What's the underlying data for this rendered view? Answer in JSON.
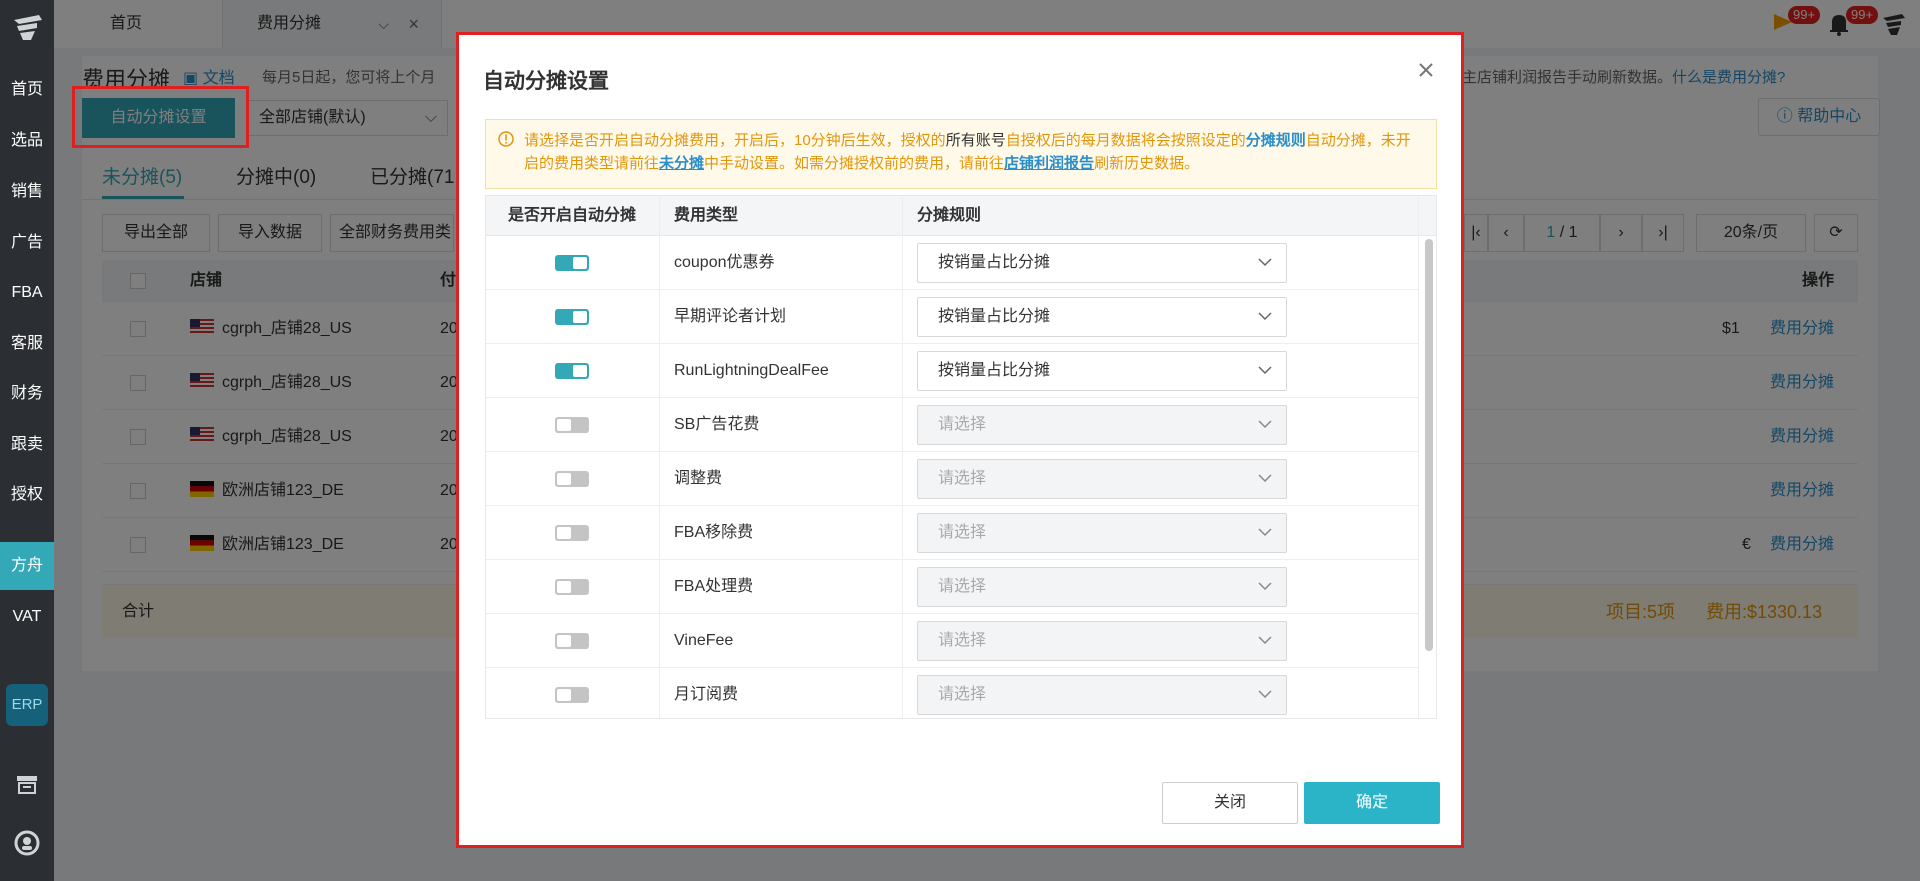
{
  "sidebar": {
    "items": [
      {
        "label": "首页"
      },
      {
        "label": "选品"
      },
      {
        "label": "销售"
      },
      {
        "label": "广告"
      },
      {
        "label": "FBA"
      },
      {
        "label": "客服"
      },
      {
        "label": "财务"
      },
      {
        "label": "跟卖"
      },
      {
        "label": "授权"
      },
      {
        "label": "方舟"
      },
      {
        "label": "VAT"
      }
    ],
    "erp_label": "ERP",
    "active_item": "方舟"
  },
  "topbar": {
    "home_tab": "首页",
    "current_tab": "费用分摊",
    "badge1": "99+",
    "badge2": "99+"
  },
  "page": {
    "title": "费用分摊",
    "doc_link": "文档",
    "desc_left": "每月5日起，您可将上个月",
    "desc_right_prefix": "主店铺利润报告手动刷新数据。",
    "desc_right_link": "什么是费用分摊?",
    "auto_button": "自动分摊设置",
    "store_select": "全部店铺(默认)",
    "help_button": "帮助中心",
    "subtabs": [
      "未分摊(5)",
      "分摊中(0)",
      "已分摊(71"
    ],
    "tool_export": "导出全部",
    "tool_import": "导入数据",
    "tool_filter": "全部财务费用类",
    "pager_current": "1",
    "pager_total": "/ 1",
    "page_size": "20条/页",
    "table_head": {
      "store": "店铺",
      "pay": "付",
      "op": "操作"
    },
    "rows": [
      {
        "store": "cgrph_店铺28_US",
        "col": "20",
        "amount": "$1",
        "op": "费用分摊"
      },
      {
        "store": "cgrph_店铺28_US",
        "col": "20",
        "amount": "",
        "op": "费用分摊"
      },
      {
        "store": "cgrph_店铺28_US",
        "col": "20",
        "amount": "",
        "op": "费用分摊"
      },
      {
        "store": "欧洲店铺123_DE",
        "col": "20",
        "amount": "",
        "op": "费用分摊"
      },
      {
        "store": "欧洲店铺123_DE",
        "col": "20",
        "amount": "€",
        "op": "费用分摊"
      }
    ],
    "sum_label": "合计",
    "sum_items": "项目:5项",
    "sum_fee": "费用:$1330.13"
  },
  "modal": {
    "title": "自动分摊设置",
    "notice": {
      "p1": "请选择是否开启自动分摊费用，开启后，10分钟后生效，授权的",
      "p2": "所有账号",
      "p3": "自授权后的每月数据将会按照设定的",
      "p4": "分摊规则",
      "p5": "自动分摊，未开启的费用类型请前往",
      "p6": "未分摊",
      "p7": "中手动设置。如需分摊授权前的费用，请前往",
      "p8": "店铺利润报告",
      "p9": "刷新历史数据。"
    },
    "columns": {
      "enable": "是否开启自动分摊",
      "type": "费用类型",
      "rule": "分摊规则"
    },
    "rows": [
      {
        "enabled": true,
        "type": "coupon优惠券",
        "rule": "按销量占比分摊"
      },
      {
        "enabled": true,
        "type": "早期评论者计划",
        "rule": "按销量占比分摊"
      },
      {
        "enabled": true,
        "type": "RunLightningDealFee",
        "rule": "按销量占比分摊"
      },
      {
        "enabled": false,
        "type": "SB广告花费",
        "rule": "请选择"
      },
      {
        "enabled": false,
        "type": "调整费",
        "rule": "请选择"
      },
      {
        "enabled": false,
        "type": "FBA移除费",
        "rule": "请选择"
      },
      {
        "enabled": false,
        "type": "FBA处理费",
        "rule": "请选择"
      },
      {
        "enabled": false,
        "type": "VineFee",
        "rule": "请选择"
      },
      {
        "enabled": false,
        "type": "月订阅费",
        "rule": "请选择"
      }
    ],
    "close_button": "关闭",
    "ok_button": "确定"
  },
  "colors": {
    "accent": "#33a9b8",
    "sidebar_bg": "#2b2f33",
    "highlight_border": "#e02020",
    "notice_text": "#e2960c",
    "link": "#2a8ec8"
  }
}
